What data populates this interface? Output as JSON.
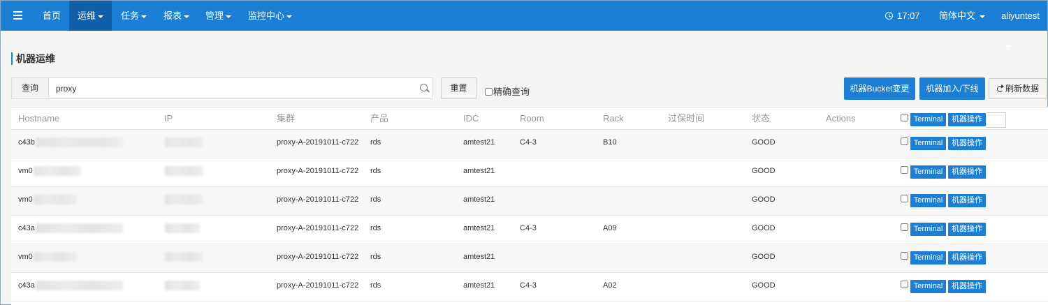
{
  "nav": {
    "items": [
      {
        "label": "首页",
        "dropdown": false
      },
      {
        "label": "运维",
        "dropdown": true
      },
      {
        "label": "任务",
        "dropdown": true
      },
      {
        "label": "报表",
        "dropdown": true
      },
      {
        "label": "管理",
        "dropdown": true
      },
      {
        "label": "监控中心",
        "dropdown": true
      }
    ],
    "time": "17:07",
    "language": "简体中文",
    "user": "aliyuntest"
  },
  "page": {
    "title": "机器运维"
  },
  "search": {
    "addon_label": "查询",
    "value": "proxy",
    "reset_label": "重置",
    "exact_label": "精确查询"
  },
  "toolbar": {
    "bucket_change_label": "机器Bucket变更",
    "join_leave_label": "机器加入/下线",
    "refresh_label": "刷新数据"
  },
  "table": {
    "headers": [
      "Hostname",
      "IP",
      "集群",
      "产品",
      "IDC",
      "Room",
      "Rack",
      "过保时间",
      "状态",
      "Actions"
    ],
    "terminal_label": "Terminal",
    "machine_op_label": "机器操作",
    "rows": [
      {
        "hostname": "c43b",
        "ip": "",
        "cluster": "proxy-A-20191011-c722",
        "product": "rds",
        "idc": "amtest21",
        "room": "C4-3",
        "rack": "B10",
        "warranty": "",
        "status": "GOOD"
      },
      {
        "hostname": "vm0",
        "ip": "",
        "cluster": "proxy-A-20191011-c722",
        "product": "rds",
        "idc": "amtest21",
        "room": "",
        "rack": "",
        "warranty": "",
        "status": "GOOD"
      },
      {
        "hostname": "vm0",
        "ip": "",
        "cluster": "proxy-A-20191011-c722",
        "product": "rds",
        "idc": "amtest21",
        "room": "",
        "rack": "",
        "warranty": "",
        "status": "GOOD"
      },
      {
        "hostname": "c43a",
        "ip": "",
        "cluster": "proxy-A-20191011-c722",
        "product": "rds",
        "idc": "amtest21",
        "room": "C4-3",
        "rack": "A09",
        "warranty": "",
        "status": "GOOD"
      },
      {
        "hostname": "vm0",
        "ip": "",
        "cluster": "proxy-A-20191011-c722",
        "product": "rds",
        "idc": "amtest21",
        "room": "",
        "rack": "",
        "warranty": "",
        "status": "GOOD"
      },
      {
        "hostname": "c43a",
        "ip": "",
        "cluster": "proxy-A-20191011-c722",
        "product": "rds",
        "idc": "amtest21",
        "room": "C4-3",
        "rack": "A02",
        "warranty": "",
        "status": "GOOD"
      }
    ]
  },
  "colors": {
    "primary": "#1b7fd6",
    "nav_active": "#105fa8"
  }
}
